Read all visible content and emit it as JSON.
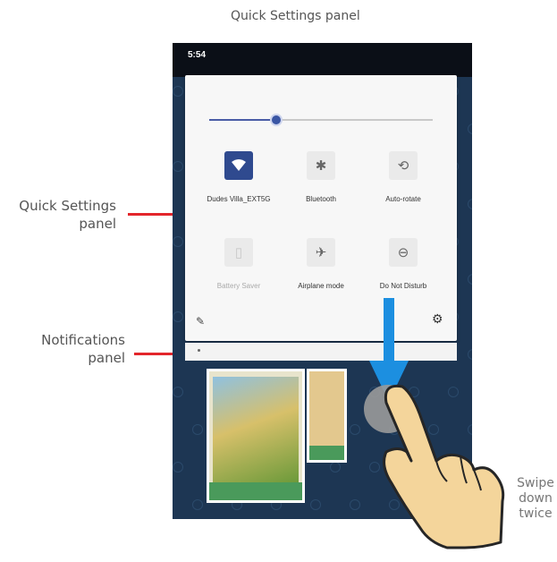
{
  "figure": {
    "title": "Quick Settings panel",
    "callout_quick_settings": "Quick Settings panel",
    "callout_notifications": "Notifications panel",
    "swipe_hint": "Swipe down twice"
  },
  "status_bar": {
    "time": "5:54"
  },
  "quick_settings": {
    "brightness_percent": 30,
    "tiles": [
      {
        "label": "Dudes Villa_EXT5G",
        "icon": "wifi-icon",
        "state": "on"
      },
      {
        "label": "Bluetooth",
        "icon": "bluetooth-icon",
        "state": "off"
      },
      {
        "label": "Auto-rotate",
        "icon": "auto-rotate-icon",
        "state": "off"
      },
      {
        "label": "Battery Saver",
        "icon": "battery-saver-icon",
        "state": "disabled"
      },
      {
        "label": "Airplane mode",
        "icon": "airplane-icon",
        "state": "off"
      },
      {
        "label": "Do Not Disturb",
        "icon": "do-not-disturb-icon",
        "state": "off"
      }
    ]
  },
  "colors": {
    "accent_blue": "#1c8fe0",
    "callout_red": "#e3262b",
    "tile_active": "#2f4a8f",
    "phone_bg": "#1d3653"
  }
}
